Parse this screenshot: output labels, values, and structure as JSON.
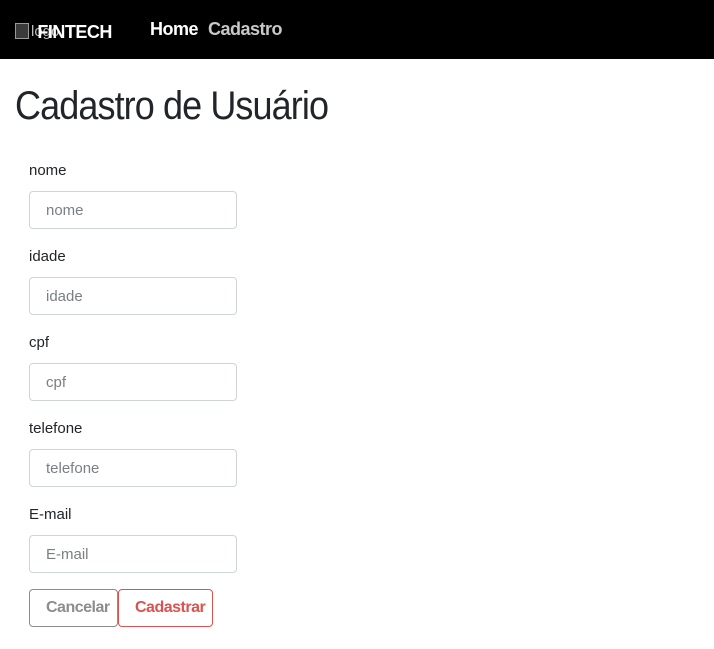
{
  "navbar": {
    "logo_alt": "logo",
    "brand": "FINTECH",
    "links": [
      {
        "label": "Home"
      },
      {
        "label": "Cadastro"
      }
    ]
  },
  "page": {
    "title": "Cadastro de Usuário"
  },
  "form": {
    "fields": [
      {
        "label": "nome",
        "placeholder": "nome",
        "value": ""
      },
      {
        "label": "idade",
        "placeholder": "idade",
        "value": ""
      },
      {
        "label": "cpf",
        "placeholder": "cpf",
        "value": ""
      },
      {
        "label": "telefone",
        "placeholder": "telefone",
        "value": ""
      },
      {
        "label": "E-mail",
        "placeholder": "E-mail",
        "value": ""
      }
    ],
    "cancel_label": "Cancelar",
    "submit_label": "Cadastrar"
  },
  "colors": {
    "navbar_bg": "#000000",
    "submit_accent": "#d9534f",
    "cancel_accent": "#8d8d8d"
  }
}
